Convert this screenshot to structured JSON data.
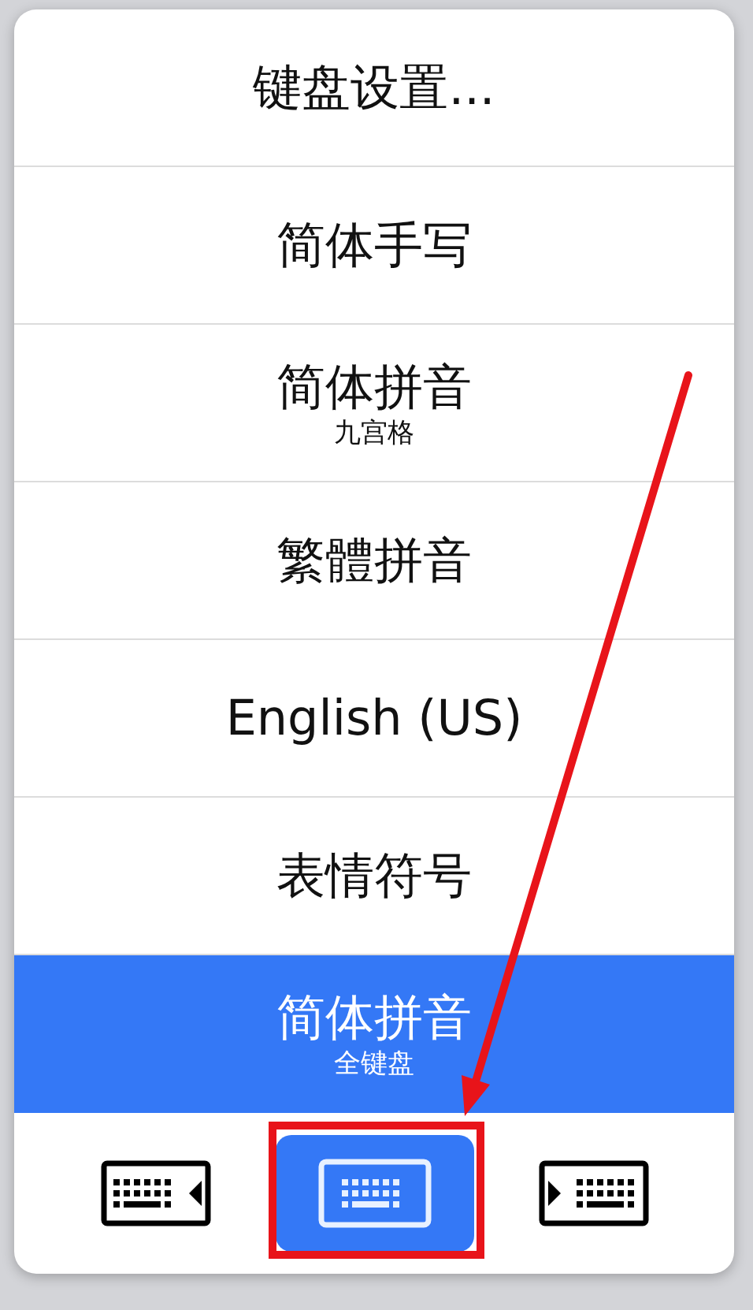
{
  "menu": {
    "items": [
      {
        "label": "键盘设置...",
        "selected": false
      },
      {
        "label": "简体手写",
        "selected": false
      },
      {
        "label": "简体拼音",
        "sublabel": "九宫格",
        "selected": false
      },
      {
        "label": "繁體拼音",
        "selected": false
      },
      {
        "label": "English (US)",
        "selected": false
      },
      {
        "label": "表情符号",
        "selected": false
      },
      {
        "label": "简体拼音",
        "sublabel": "全键盘",
        "selected": true
      }
    ]
  },
  "layout_buttons": [
    {
      "kind": "dock-left",
      "selected": false
    },
    {
      "kind": "full",
      "selected": true
    },
    {
      "kind": "dock-right",
      "selected": false
    }
  ]
}
